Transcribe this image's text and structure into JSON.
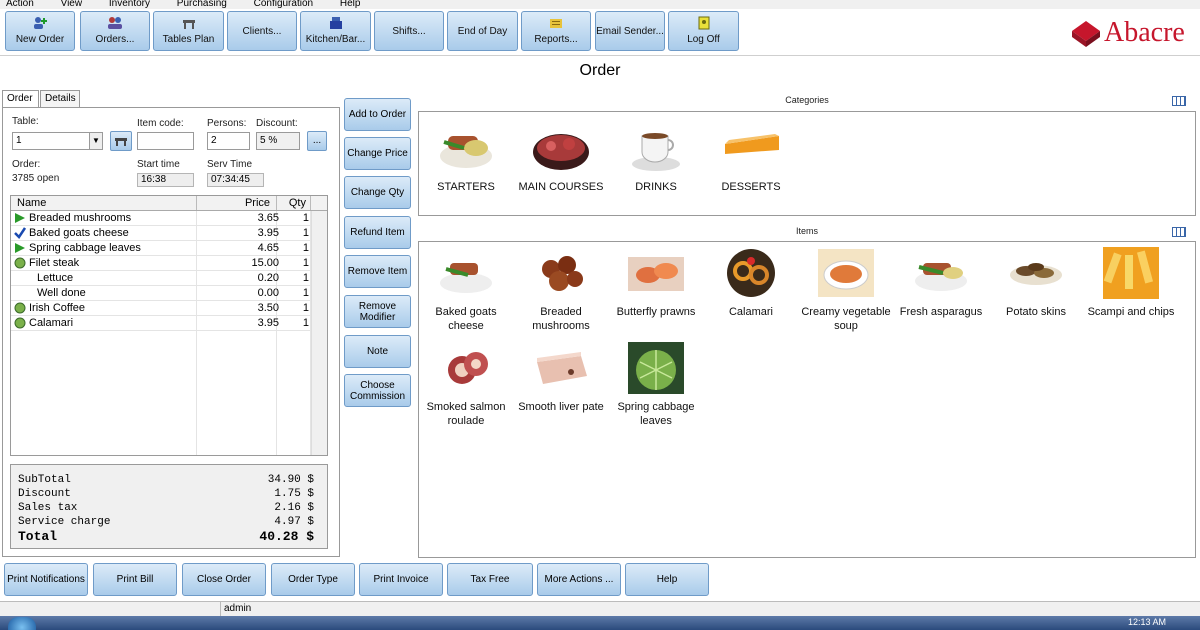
{
  "menu": [
    "Action",
    "View",
    "Inventory",
    "Purchasing",
    "Configuration",
    "Help"
  ],
  "toolbar": {
    "buttons": [
      "New Order",
      "Orders...",
      "Tables Plan",
      "Clients...",
      "Kitchen/Bar...",
      "Shifts...",
      "End of Day",
      "Reports...",
      "Email Sender...",
      "Log Off"
    ]
  },
  "brand": {
    "logo_text": "Abacre",
    "color": "#c6162c"
  },
  "page_title": "Order",
  "tabs": [
    "Order",
    "Details"
  ],
  "form": {
    "table_label": "Table:",
    "table_value": "1",
    "item_code_label": "Item code:",
    "item_code_value": "",
    "persons_label": "Persons:",
    "persons_value": "2",
    "discount_label": "Discount:",
    "discount_value": "5 %",
    "more_btn": "...",
    "order_label": "Order:",
    "order_value": "3785 open",
    "start_label": "Start time",
    "start_value": "16:38",
    "serv_label": "Serv Time",
    "serv_value": "07:34:45"
  },
  "order_table": {
    "columns": [
      "Name",
      "Price",
      "Qty"
    ],
    "rows": [
      {
        "name": "Breaded mushrooms",
        "price": "3.65",
        "qty": "1",
        "icon": "play-icon"
      },
      {
        "name": "Baked goats cheese",
        "price": "3.95",
        "qty": "1",
        "icon": "check-icon"
      },
      {
        "name": "Spring cabbage leaves",
        "price": "4.65",
        "qty": "1",
        "icon": "play-icon"
      },
      {
        "name": "Filet steak",
        "price": "15.00",
        "qty": "1",
        "icon": "circle-icon"
      },
      {
        "name": "Lettuce",
        "price": "0.20",
        "qty": "1",
        "icon": ""
      },
      {
        "name": "Well done",
        "price": "0.00",
        "qty": "1",
        "icon": ""
      },
      {
        "name": "Irish Coffee",
        "price": "3.50",
        "qty": "1",
        "icon": "circle-icon"
      },
      {
        "name": "Calamari",
        "price": "3.95",
        "qty": "1",
        "icon": "circle-icon"
      }
    ]
  },
  "totals": {
    "subtotal_label": "SubTotal",
    "subtotal": "34.90 $",
    "discount_label": "Discount",
    "discount": "1.75 $",
    "tax_label": "Sales tax",
    "tax": "2.16 $",
    "service_label": "Service charge",
    "service": "4.97 $",
    "total_label": "Total",
    "total": "40.28 $"
  },
  "actions": [
    "Add to Order",
    "Change Price",
    "Change Qty",
    "Refund Item",
    "Remove Item",
    "Remove Modifier",
    "Note",
    "Choose Commission"
  ],
  "categories_label": "Categories",
  "categories": [
    "STARTERS",
    "MAIN COURSES",
    "DRINKS",
    "DESSERTS"
  ],
  "items_label": "Items",
  "items": [
    "Baked goats cheese",
    "Breaded mushrooms",
    "Butterfly prawns",
    "Calamari",
    "Creamy vegetable soup",
    "Fresh asparagus",
    "Potato skins",
    "Scampi and chips",
    "Smoked salmon roulade",
    "Smooth liver pate",
    "Spring cabbage leaves"
  ],
  "bottom_buttons": [
    "Print Notifications",
    "Print Bill",
    "Close Order",
    "Order Type",
    "Print Invoice",
    "Tax Free",
    "More Actions ...",
    "Help"
  ],
  "status": {
    "user": "admin"
  },
  "clock": "12:13 AM"
}
